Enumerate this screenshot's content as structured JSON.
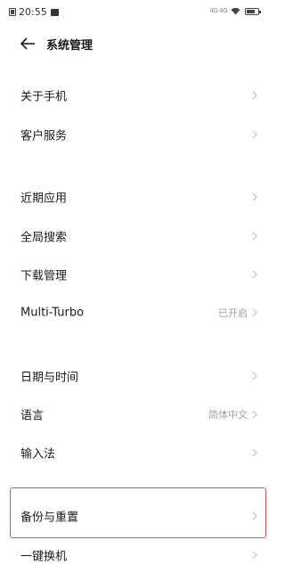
{
  "status_bar": {
    "time": "20:55",
    "signal_text": "4G 4G"
  },
  "header": {
    "title": "系统管理"
  },
  "sections": [
    {
      "items": [
        {
          "label": "关于手机",
          "value": ""
        },
        {
          "label": "客户服务",
          "value": ""
        }
      ]
    },
    {
      "items": [
        {
          "label": "近期应用",
          "value": ""
        },
        {
          "label": "全局搜索",
          "value": ""
        },
        {
          "label": "下载管理",
          "value": ""
        },
        {
          "label": "Multi-Turbo",
          "value": "已开启"
        }
      ]
    },
    {
      "items": [
        {
          "label": "日期与时间",
          "value": ""
        },
        {
          "label": "语言",
          "value": "简体中文"
        },
        {
          "label": "输入法",
          "value": ""
        }
      ]
    },
    {
      "items": [
        {
          "label": "备份与重置",
          "value": ""
        },
        {
          "label": "一键换机",
          "value": ""
        }
      ]
    }
  ],
  "colors": {
    "highlight": "#d9534f",
    "secondary_text": "#a0a0a0",
    "chevron": "#c0c0c0"
  }
}
